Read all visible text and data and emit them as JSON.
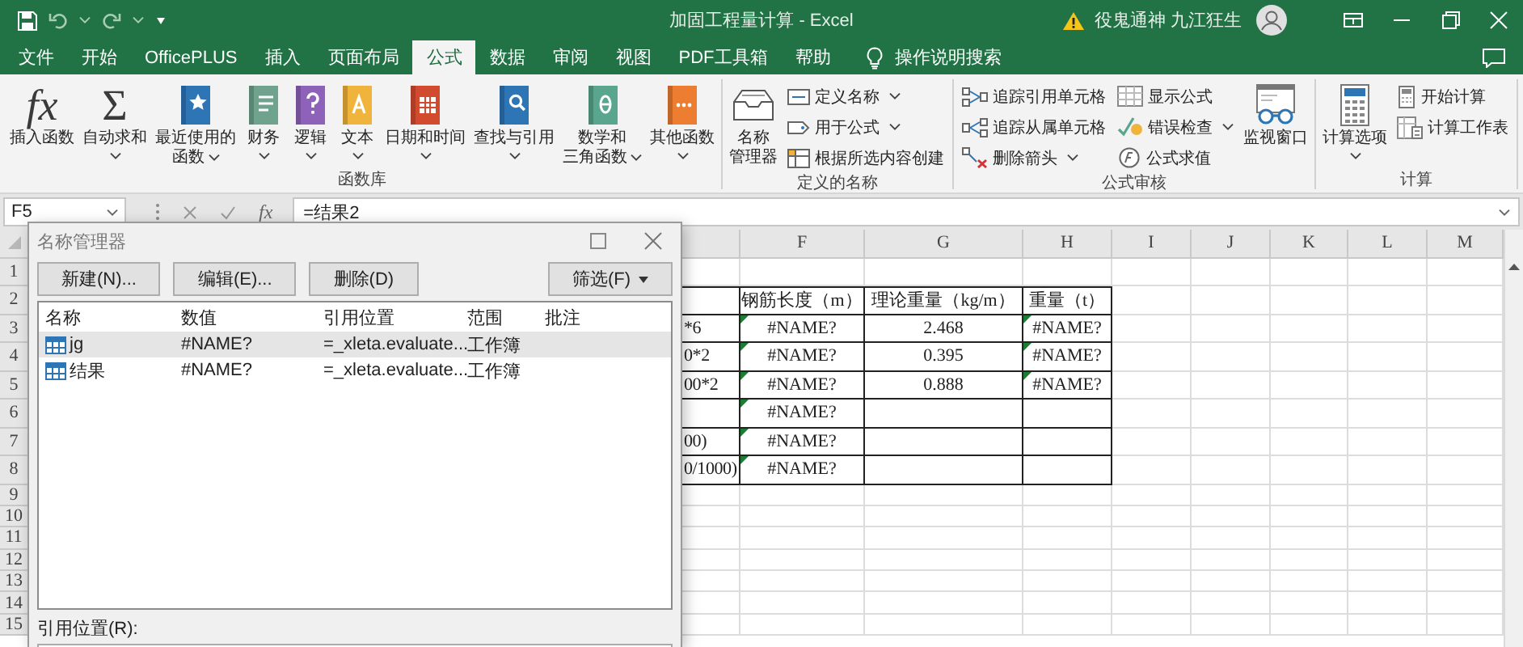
{
  "title_bar": {
    "title": "加固工程量计算 - Excel",
    "user": "役鬼通神 九江狂生"
  },
  "tabs": [
    {
      "label": "文件",
      "selected": false
    },
    {
      "label": "开始",
      "selected": false
    },
    {
      "label": "OfficePLUS",
      "selected": false
    },
    {
      "label": "插入",
      "selected": false
    },
    {
      "label": "页面布局",
      "selected": false
    },
    {
      "label": "公式",
      "selected": true
    },
    {
      "label": "数据",
      "selected": false
    },
    {
      "label": "审阅",
      "selected": false
    },
    {
      "label": "视图",
      "selected": false
    },
    {
      "label": "PDF工具箱",
      "selected": false
    },
    {
      "label": "帮助",
      "selected": false
    }
  ],
  "tell_me": "操作说明搜索",
  "ribbon": {
    "groups": [
      {
        "label": "函数库",
        "items": [
          {
            "label": "插入函数",
            "glyph": "fx",
            "kind": "large",
            "dropdown": false
          },
          {
            "label": "自动求和",
            "glyph": "Σ",
            "kind": "large",
            "dropdown": true
          },
          {
            "label": "最近使用的函数",
            "kind": "large",
            "dropdown": true
          },
          {
            "label": "财务",
            "kind": "large",
            "dropdown": true
          },
          {
            "label": "逻辑",
            "kind": "large",
            "dropdown": true
          },
          {
            "label": "文本",
            "kind": "large",
            "dropdown": true
          },
          {
            "label": "日期和时间",
            "kind": "large",
            "dropdown": true
          },
          {
            "label": "查找与引用",
            "kind": "large",
            "dropdown": true
          },
          {
            "label": "数学和三角函数",
            "kind": "large",
            "dropdown": true
          },
          {
            "label": "其他函数",
            "kind": "large",
            "dropdown": true
          }
        ]
      },
      {
        "label": "定义的名称",
        "items": [
          {
            "label": "名称管理器",
            "kind": "large",
            "dropdown": false
          },
          {
            "label": "定义名称",
            "kind": "small",
            "dropdown": true
          },
          {
            "label": "用于公式",
            "kind": "small",
            "dropdown": true
          },
          {
            "label": "根据所选内容创建",
            "kind": "small",
            "dropdown": false
          }
        ]
      },
      {
        "label": "公式审核",
        "items": [
          {
            "label": "追踪引用单元格",
            "kind": "small",
            "dropdown": false
          },
          {
            "label": "追踪从属单元格",
            "kind": "small",
            "dropdown": false
          },
          {
            "label": "删除箭头",
            "kind": "small",
            "dropdown": true
          },
          {
            "label": "显示公式",
            "kind": "small",
            "dropdown": false
          },
          {
            "label": "错误检查",
            "kind": "small",
            "dropdown": true
          },
          {
            "label": "公式求值",
            "kind": "small",
            "dropdown": false
          },
          {
            "label": "监视窗口",
            "kind": "large",
            "dropdown": false
          }
        ]
      },
      {
        "label": "计算",
        "items": [
          {
            "label": "计算选项",
            "kind": "large",
            "dropdown": true
          },
          {
            "label": "开始计算",
            "kind": "small",
            "dropdown": false
          },
          {
            "label": "计算工作表",
            "kind": "small",
            "dropdown": false
          }
        ]
      }
    ]
  },
  "formula_bar": {
    "name_box": "F5",
    "function_glyph": "fx",
    "formula": "=结果2"
  },
  "sheet": {
    "column_headers": [
      "F",
      "G",
      "H",
      "I",
      "J",
      "K",
      "L",
      "M"
    ],
    "rows": [
      {
        "number": "1"
      },
      {
        "number": "2",
        "cells": [
          {
            "boxed": true,
            "flag": false
          },
          {
            "text": "钢筋长度（m）",
            "boxed": true,
            "flag": false
          },
          {
            "text": "理论重量（kg/m）",
            "boxed": true,
            "flag": false
          },
          {
            "text": "重量（t）",
            "boxed": true,
            "flag": false
          }
        ]
      },
      {
        "number": "3",
        "cells": [
          {
            "text": "*6",
            "boxed": true,
            "flag": false
          },
          {
            "text": "#NAME?",
            "boxed": true,
            "flag": true
          },
          {
            "text": "2.468",
            "boxed": true,
            "flag": false
          },
          {
            "text": "#NAME?",
            "boxed": true,
            "flag": true
          }
        ]
      },
      {
        "number": "4",
        "cells": [
          {
            "text": "0*2",
            "boxed": true,
            "flag": false
          },
          {
            "text": "#NAME?",
            "boxed": true,
            "flag": true
          },
          {
            "text": "0.395",
            "boxed": true,
            "flag": false
          },
          {
            "text": "#NAME?",
            "boxed": true,
            "flag": true
          }
        ]
      },
      {
        "number": "5",
        "cells": [
          {
            "text": "00*2",
            "boxed": true,
            "flag": false
          },
          {
            "text": "#NAME?",
            "boxed": true,
            "flag": true
          },
          {
            "text": "0.888",
            "boxed": true,
            "flag": false
          },
          {
            "text": "#NAME?",
            "boxed": true,
            "flag": true
          }
        ]
      },
      {
        "number": "6",
        "cells": [
          {
            "boxed": true,
            "flag": false
          },
          {
            "text": "#NAME?",
            "boxed": true,
            "flag": true
          },
          {
            "boxed": true,
            "flag": false
          },
          {
            "boxed": true,
            "flag": false
          }
        ]
      },
      {
        "number": "7",
        "cells": [
          {
            "text": "00)",
            "boxed": true,
            "flag": false
          },
          {
            "text": "#NAME?",
            "boxed": true,
            "flag": true
          },
          {
            "boxed": true,
            "flag": false
          },
          {
            "boxed": true,
            "flag": false
          }
        ]
      },
      {
        "number": "8",
        "cells": [
          {
            "text": "0/1000)",
            "boxed": true,
            "flag": false
          },
          {
            "text": "#NAME?",
            "boxed": true,
            "flag": true
          },
          {
            "boxed": true,
            "flag": false
          },
          {
            "boxed": true,
            "flag": false
          }
        ]
      },
      {
        "number": "9"
      },
      {
        "number": "10"
      },
      {
        "number": "11"
      },
      {
        "number": "12"
      },
      {
        "number": "13"
      },
      {
        "number": "14"
      },
      {
        "number": "15"
      }
    ]
  },
  "dialog": {
    "title": "名称管理器",
    "buttons": [
      "新建(N)...",
      "编辑(E)...",
      "删除(D)"
    ],
    "filter_button": "筛选(F)",
    "columns": [
      "名称",
      "数值",
      "引用位置",
      "范围",
      "批注"
    ],
    "names": [
      {
        "name": "jg",
        "value": "#NAME?",
        "refers_to": "=_xleta.evaluate...",
        "scope": "工作簿",
        "selected": true
      },
      {
        "name": "结果",
        "value": "#NAME?",
        "refers_to": "=_xleta.evaluate...",
        "scope": "工作簿",
        "selected": false
      }
    ],
    "refers_to_label": "引用位置(R):"
  }
}
